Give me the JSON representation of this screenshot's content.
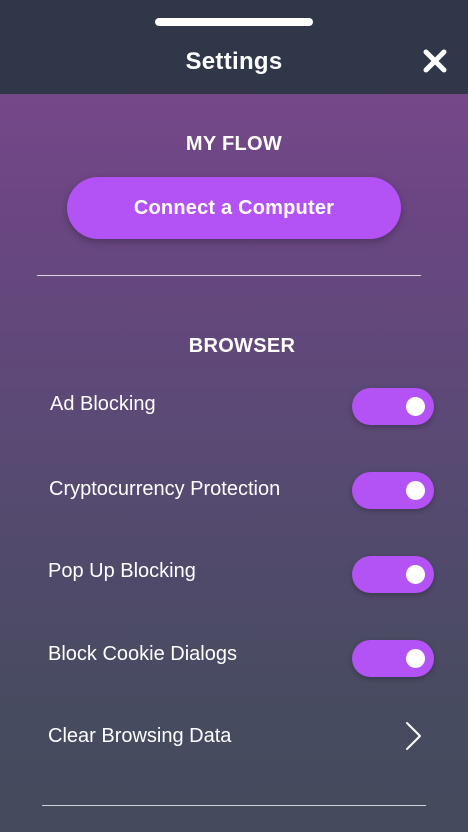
{
  "header": {
    "title": "Settings"
  },
  "my_flow": {
    "section_title": "MY FLOW",
    "connect_button_label": "Connect a Computer"
  },
  "browser": {
    "section_title": "BROWSER",
    "items": [
      {
        "label": "Ad Blocking",
        "toggle_on": true
      },
      {
        "label": "Cryptocurrency Protection",
        "toggle_on": true
      },
      {
        "label": "Pop Up Blocking",
        "toggle_on": true
      },
      {
        "label": "Block Cookie Dialogs",
        "toggle_on": true
      }
    ],
    "clear_data_label": "Clear Browsing Data"
  },
  "colors": {
    "accent": "#b352f5",
    "header_bg": "#2f3749"
  },
  "icons": {
    "close": "close-icon",
    "chevron": "chevron-right-icon"
  }
}
